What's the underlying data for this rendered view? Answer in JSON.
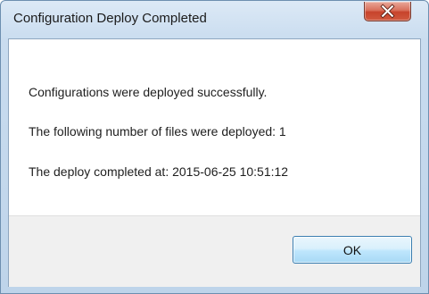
{
  "window": {
    "title": "Configuration Deploy Completed"
  },
  "icons": {
    "close": "close-icon"
  },
  "message": {
    "line1": "Configurations were deployed successfully.",
    "line2": "The following number of files were deployed: 1",
    "line3": "The deploy completed at: 2015-06-25 10:51:12"
  },
  "buttons": {
    "ok_label": "OK"
  },
  "colors": {
    "close_button": "#c7432b",
    "ok_button_border": "#3c7fb1",
    "footer_background": "#f0f0f0"
  }
}
